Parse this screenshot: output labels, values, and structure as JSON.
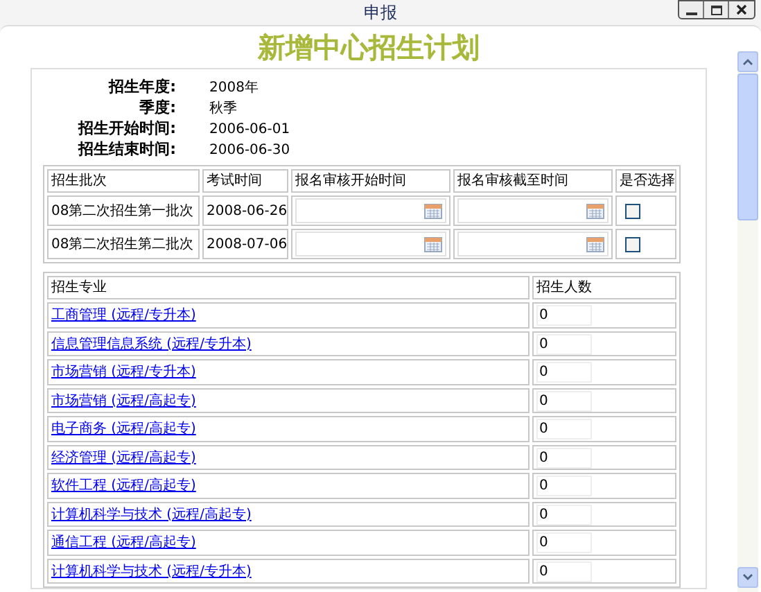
{
  "window": {
    "title": "申报"
  },
  "heading": "新增中心招生计划",
  "info": [
    {
      "label": "招生年度:",
      "value": "2008年"
    },
    {
      "label": "季度:",
      "value": "秋季"
    },
    {
      "label": "招生开始时间:",
      "value": "2006-06-01"
    },
    {
      "label": "招生结束时间:",
      "value": "2006-06-30"
    }
  ],
  "batch_table": {
    "columns": [
      "招生批次",
      "考试时间",
      "报名审核开始时间",
      "报名审核截至时间",
      "是否选择"
    ],
    "rows": [
      {
        "batch": "08第二次招生第一批次",
        "exam_date": "2008-06-26",
        "checked": false
      },
      {
        "batch": "08第二次招生第二批次",
        "exam_date": "2008-07-06",
        "checked": false
      }
    ]
  },
  "major_table": {
    "columns": [
      "招生专业",
      "招生人数"
    ],
    "rows": [
      {
        "major": "工商管理 (远程/专升本)",
        "count": "0"
      },
      {
        "major": "信息管理信息系统 (远程/专升本)",
        "count": "0"
      },
      {
        "major": "市场营销 (远程/专升本)",
        "count": "0"
      },
      {
        "major": "市场营销 (远程/高起专)",
        "count": "0"
      },
      {
        "major": "电子商务 (远程/高起专)",
        "count": "0"
      },
      {
        "major": "经济管理 (远程/高起专)",
        "count": "0"
      },
      {
        "major": "软件工程 (远程/高起专)",
        "count": "0"
      },
      {
        "major": "计算机科学与技术 (远程/高起专)",
        "count": "0"
      },
      {
        "major": "通信工程 (远程/高起专)",
        "count": "0"
      },
      {
        "major": "计算机科学与技术 (远程/专升本)",
        "count": "0"
      }
    ]
  }
}
